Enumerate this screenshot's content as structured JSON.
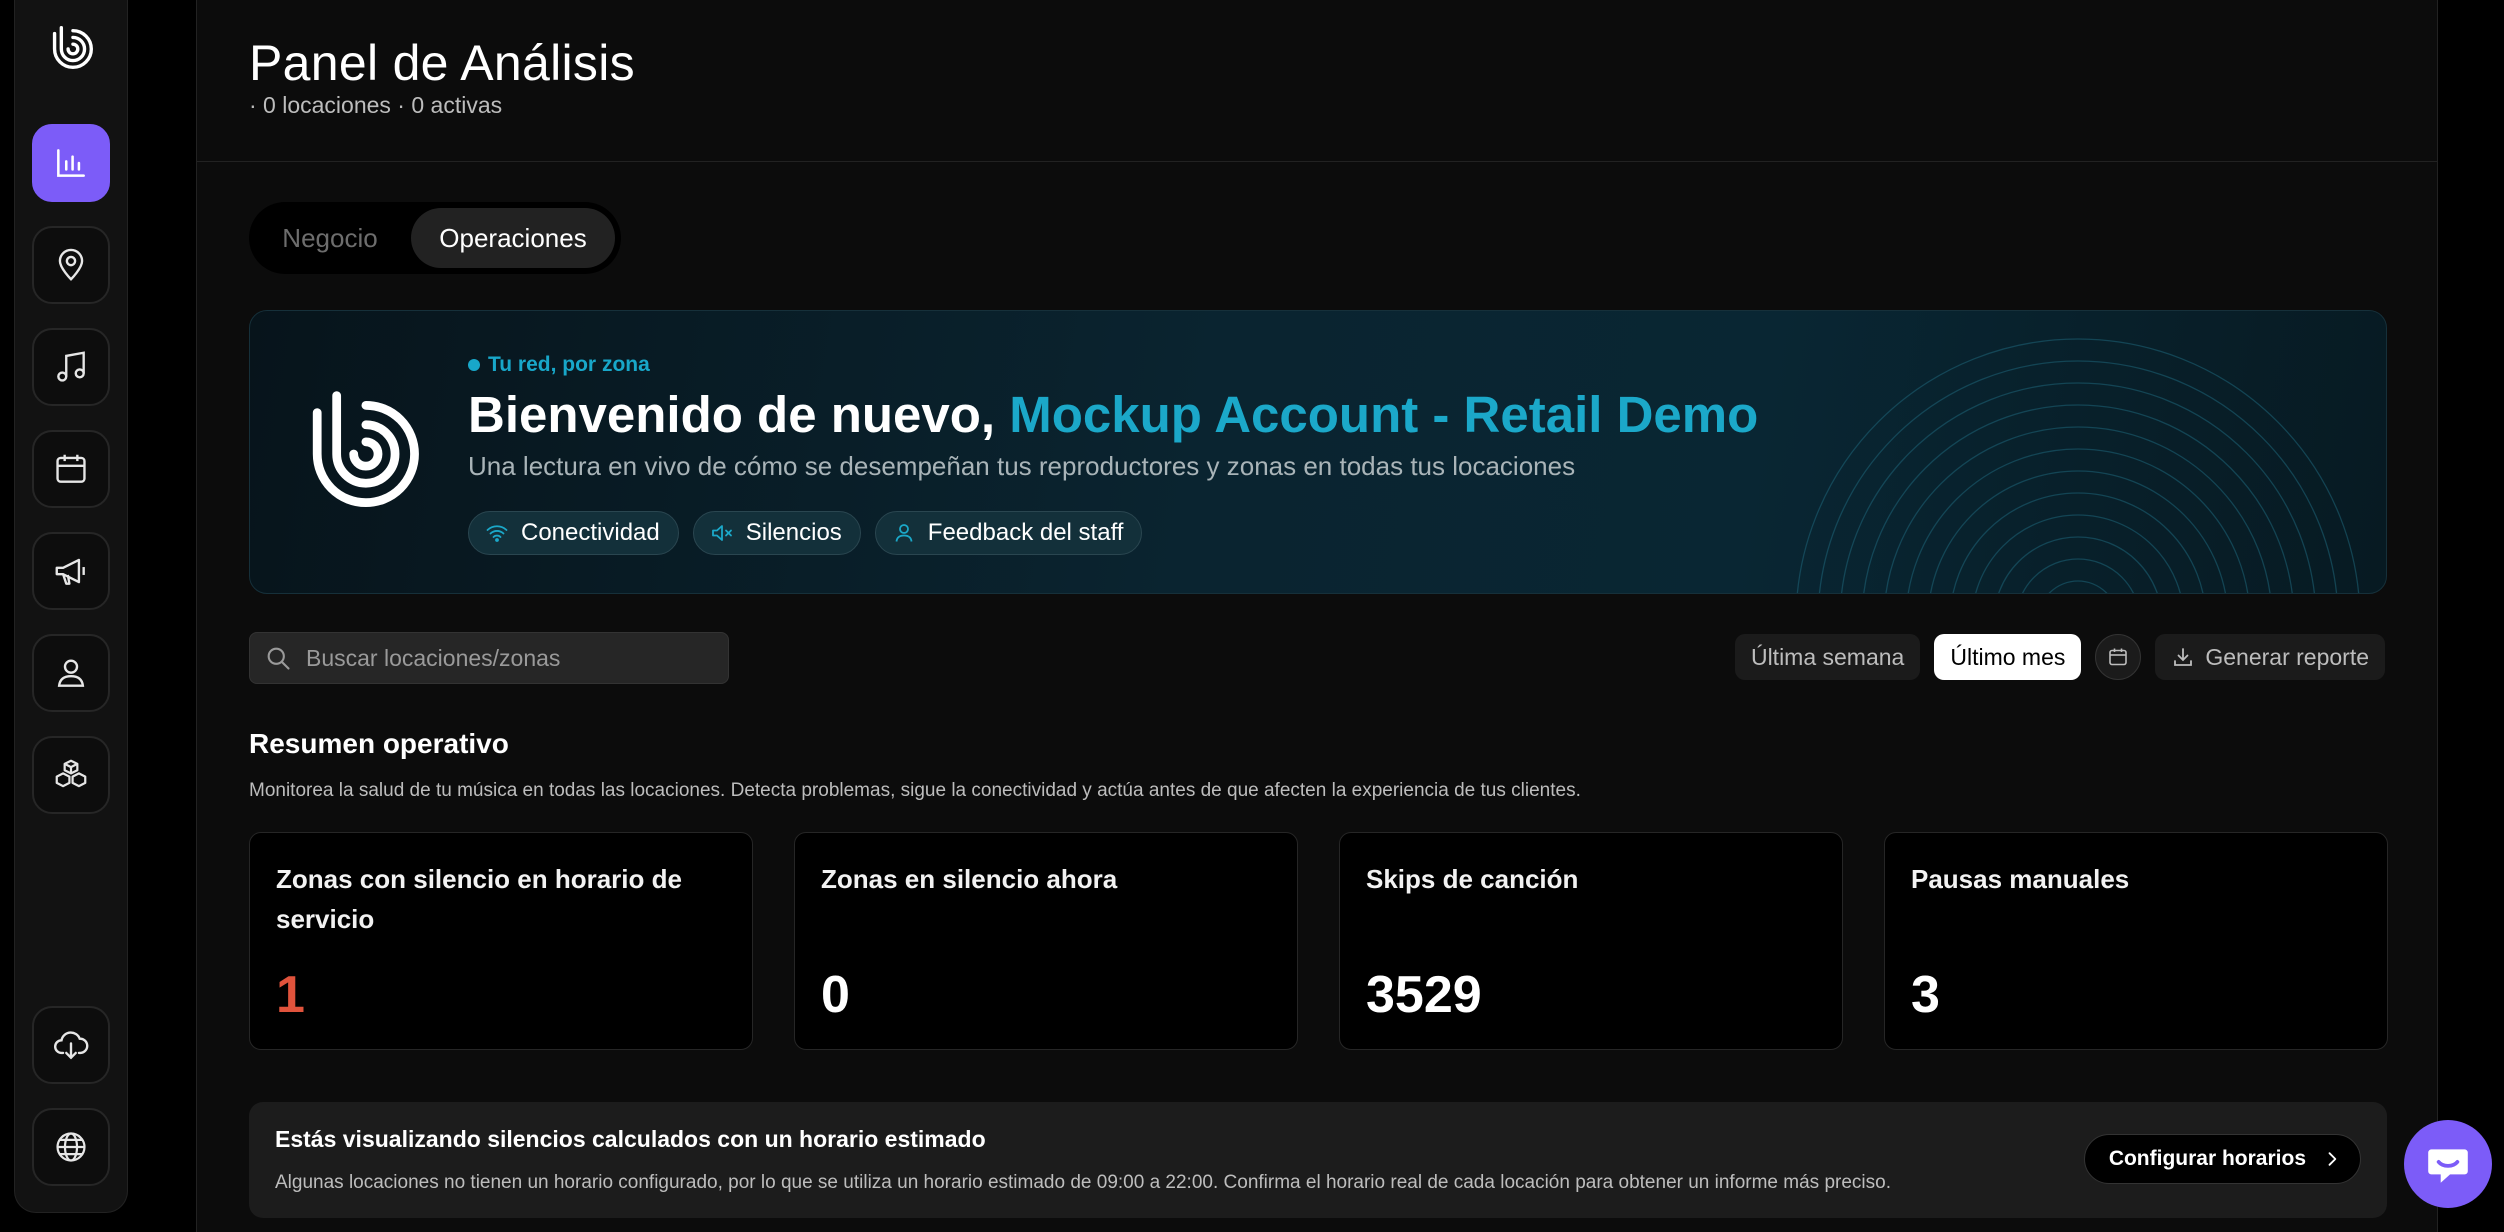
{
  "sidebar": {
    "items": [
      {
        "icon": "analytics-icon",
        "active": true
      },
      {
        "icon": "location-pin-icon",
        "active": false
      },
      {
        "icon": "music-note-icon",
        "active": false
      },
      {
        "icon": "calendar-icon",
        "active": false
      },
      {
        "icon": "megaphone-icon",
        "active": false
      },
      {
        "icon": "user-icon",
        "active": false
      },
      {
        "icon": "boxes-icon",
        "active": false
      }
    ],
    "bottom_items": [
      {
        "icon": "cloud-download-icon"
      },
      {
        "icon": "globe-icon"
      }
    ]
  },
  "header": {
    "title": "Panel de Análisis",
    "subtitle": "· 0 locaciones · 0 activas"
  },
  "tabs": [
    {
      "label": "Negocio",
      "active": false
    },
    {
      "label": "Operaciones",
      "active": true
    }
  ],
  "banner": {
    "tag": "Tu red, por zona",
    "greeting": "Bienvenido de nuevo,",
    "account": "Mockup Account - Retail Demo",
    "description": "Una lectura en vivo de cómo se desempeñan tus reproductores y zonas en todas tus locaciones",
    "chips": [
      {
        "label": "Conectividad",
        "icon": "wifi-icon"
      },
      {
        "label": "Silencios",
        "icon": "speaker-mute-icon"
      },
      {
        "label": "Feedback del staff",
        "icon": "user-icon"
      }
    ],
    "accent_color": "#1ba8c9"
  },
  "toolbar": {
    "search_placeholder": "Buscar locaciones/zonas",
    "filters": [
      {
        "label": "Última semana",
        "active": false
      },
      {
        "label": "Último mes",
        "active": true
      }
    ],
    "report_label": "Generar reporte"
  },
  "summary": {
    "title": "Resumen operativo",
    "description": "Monitorea la salud de tu música en todas las locaciones. Detecta problemas, sigue la conectividad y actúa antes de que afecten la experiencia de tus clientes.",
    "cards": [
      {
        "label": "Zonas con silencio en horario de servicio",
        "value": "1",
        "alert": true
      },
      {
        "label": "Zonas en silencio ahora",
        "value": "0",
        "alert": false
      },
      {
        "label": "Skips de canción",
        "value": "3529",
        "alert": false
      },
      {
        "label": "Pausas manuales",
        "value": "3",
        "alert": false
      }
    ]
  },
  "notice": {
    "title": "Estás visualizando silencios calculados con un horario estimado",
    "description": "Algunas locaciones no tienen un horario configurado, por lo que se utiliza un horario estimado de 09:00 a 22:00. Confirma el horario real de cada locación para obtener un informe más preciso.",
    "button_label": "Configurar horarios"
  },
  "colors": {
    "brand_purple": "#7c5cf8",
    "alert_red": "#e0533c"
  }
}
